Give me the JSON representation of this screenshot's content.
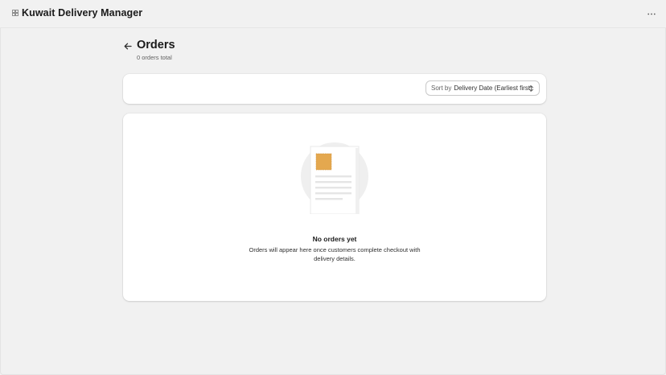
{
  "app": {
    "title": "Kuwait Delivery Manager",
    "icon": "app-grid-icon",
    "menu_icon": "more-horizontal-icon"
  },
  "page": {
    "title": "Orders",
    "subtitle": "0 orders total",
    "back_icon": "arrow-left-icon"
  },
  "sort": {
    "prefix": "Sort by",
    "value": "Delivery Date (Earliest first)",
    "icon": "select-chevrons-icon"
  },
  "empty_state": {
    "illustration": "empty-document-illustration",
    "heading": "No orders yet",
    "body": "Orders will appear here once customers complete checkout with delivery details."
  },
  "colors": {
    "background": "#f1f1f1",
    "card": "#ffffff",
    "accent": "#e4a84f",
    "text": "#303030"
  }
}
